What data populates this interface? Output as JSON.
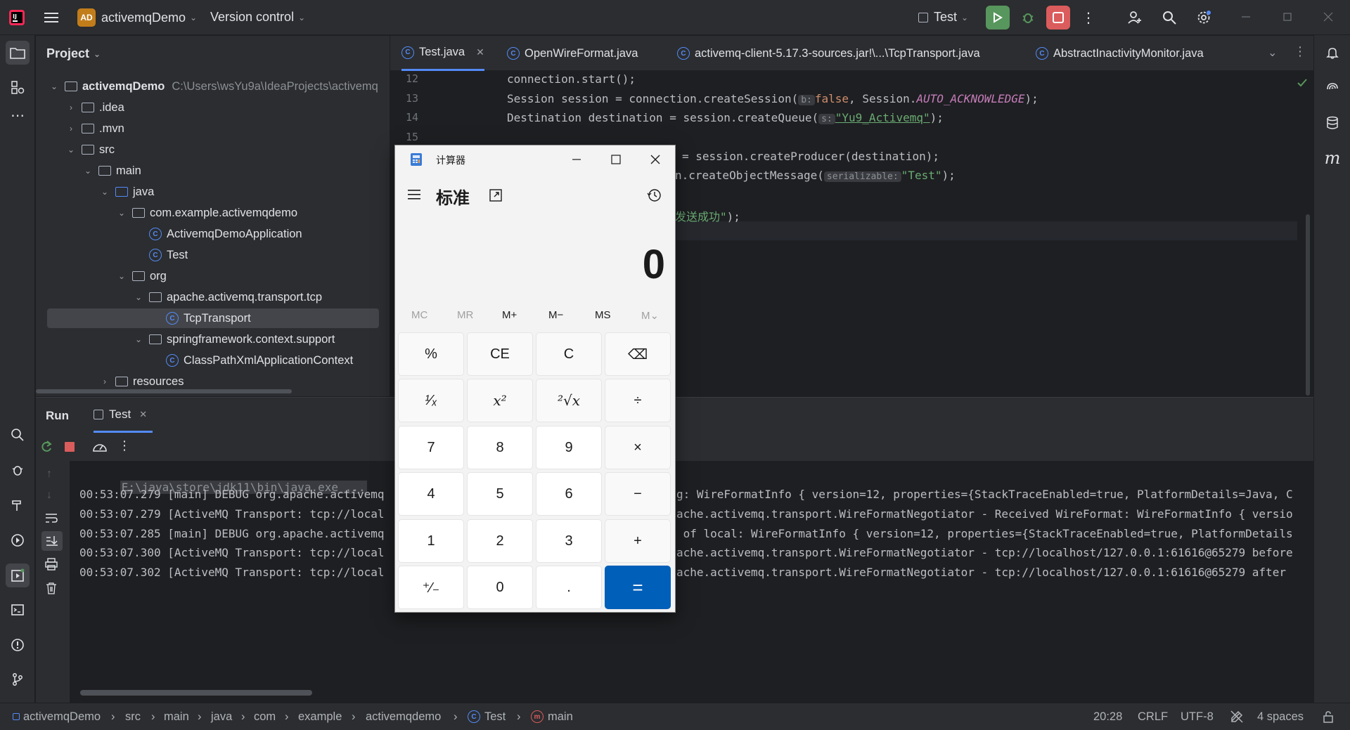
{
  "topbar": {
    "project_badge": "AD",
    "project_name": "activemqDemo",
    "vcs": "Version control",
    "run_config": "Test"
  },
  "project_panel": {
    "title": "Project",
    "tree": [
      {
        "label": "activemqDemo",
        "path": "C:\\Users\\wsYu9a\\IdeaProjects\\activemq"
      },
      {
        "label": ".idea"
      },
      {
        "label": ".mvn"
      },
      {
        "label": "src"
      },
      {
        "label": "main"
      },
      {
        "label": "java"
      },
      {
        "label": "com.example.activemqdemo"
      },
      {
        "label": "ActivemqDemoApplication"
      },
      {
        "label": "Test"
      },
      {
        "label": "org"
      },
      {
        "label": "apache.activemq.transport.tcp"
      },
      {
        "label": "TcpTransport"
      },
      {
        "label": "springframework.context.support"
      },
      {
        "label": "ClassPathXmlApplicationContext"
      },
      {
        "label": "resources"
      }
    ]
  },
  "editor": {
    "tabs": [
      {
        "label": "Test.java",
        "active": true
      },
      {
        "label": "OpenWireFormat.java"
      },
      {
        "label": "activemq-client-5.17.3-sources.jar!\\...\\TcpTransport.java"
      },
      {
        "label": "AbstractInactivityMonitor.java"
      }
    ],
    "line_numbers": [
      "12",
      "13",
      "14",
      "15"
    ],
    "lines": {
      "l12": "connection.start();",
      "l13_a": "Session session = connection.createSession(",
      "l13_hint": "b:",
      "l13_kw": "false",
      "l13_b": ", Session.",
      "l13_field": "AUTO_ACKNOWLEDGE",
      "l13_c": ");",
      "l14_a": "Destination destination = session.createQueue(",
      "l14_hint": "s:",
      "l14_str": "\"Yu9_Activemq\"",
      "l14_c": ");",
      "l16": "= session.createProducer(destination);",
      "l17_a": "n.createObjectMessage(",
      "l17_hint": "serializable:",
      "l17_str": "\"Test\"",
      "l17_c": ");",
      "l19_str": "发送成功\"",
      "l19_c": ");"
    }
  },
  "run": {
    "title": "Run",
    "tab": "Test",
    "cmd": "E:\\java\\store\\jdk11\\bin\\java.exe ...",
    "logs": [
      {
        "left": "00:53:07.279 [main] DEBUG org.apache.activemq",
        "right": "g: WireFormatInfo { version=12, properties={StackTraceEnabled=true, PlatformDetails=Java, C"
      },
      {
        "left": "00:53:07.279 [ActiveMQ Transport: tcp://local",
        "right": "ache.activemq.transport.WireFormatNegotiator - Received WireFormat: WireFormatInfo { versio"
      },
      {
        "left": "00:53:07.285 [main] DEBUG org.apache.activemq",
        "right": " of local: WireFormatInfo { version=12, properties={StackTraceEnabled=true, PlatformDetails"
      },
      {
        "left": "00:53:07.300 [ActiveMQ Transport: tcp://local",
        "right": "ache.activemq.transport.WireFormatNegotiator - tcp://localhost/127.0.0.1:61616@65279 before"
      },
      {
        "left": "00:53:07.302 [ActiveMQ Transport: tcp://local",
        "right": "ache.activemq.transport.WireFormatNegotiator - tcp://localhost/127.0.0.1:61616@65279 after"
      }
    ]
  },
  "statusbar": {
    "crumbs": [
      "activemqDemo",
      "src",
      "main",
      "java",
      "com",
      "example",
      "activemqdemo",
      "Test",
      "main"
    ],
    "position": "20:28",
    "line_sep": "CRLF",
    "encoding": "UTF-8",
    "indent": "4 spaces"
  },
  "calculator": {
    "title": "计算器",
    "mode": "标准",
    "display": "0",
    "memory": [
      "MC",
      "MR",
      "M+",
      "M−",
      "MS",
      "M⌄"
    ],
    "keys": [
      [
        "%",
        "CE",
        "C",
        "⌫"
      ],
      [
        "¹⁄ₓ",
        "x²",
        "²√x",
        "÷"
      ],
      [
        "7",
        "8",
        "9",
        "×"
      ],
      [
        "4",
        "5",
        "6",
        "−"
      ],
      [
        "1",
        "2",
        "3",
        "+"
      ],
      [
        "⁺⁄₋",
        "0",
        ".",
        "="
      ]
    ]
  },
  "colors": {
    "accent": "#548af7",
    "calc_equals": "#005fb8",
    "run_green": "#57965c",
    "stop_red": "#db5c5c"
  }
}
